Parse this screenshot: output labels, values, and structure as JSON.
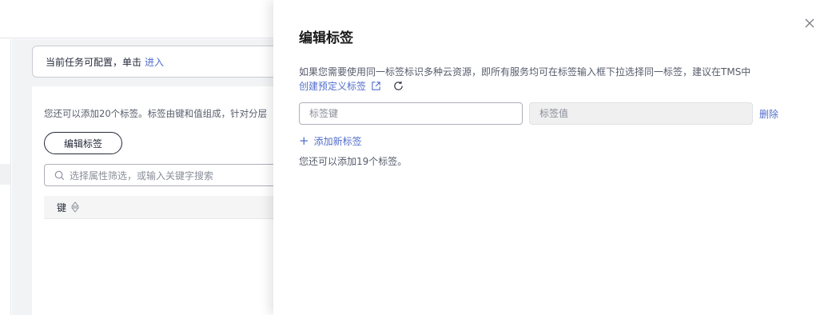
{
  "background": {
    "tip": {
      "text": "当前任务可配置，单击",
      "link": "进入"
    },
    "desc": "您还可以添加20个标签。标签由键和值组成，针对分层",
    "edit_button": "编辑标签",
    "search_placeholder": "选择属性筛选，或输入关键字搜索",
    "table_header": {
      "key": "键"
    }
  },
  "drawer": {
    "title": "编辑标签",
    "notice": "如果您需要使用同一标签标识多种云资源，即所有服务均可在标签输入框下拉选择同一标签，建议在TMS中",
    "create_link": "创建预定义标签",
    "key_placeholder": "标签键",
    "value_placeholder": "标签值",
    "delete_label": "删除",
    "add_label": "添加新标签",
    "remaining_text": "您还可以添加19个标签。"
  },
  "colors": {
    "link": "#526ecc",
    "text": "#252b3a",
    "muted": "#575d6c"
  }
}
